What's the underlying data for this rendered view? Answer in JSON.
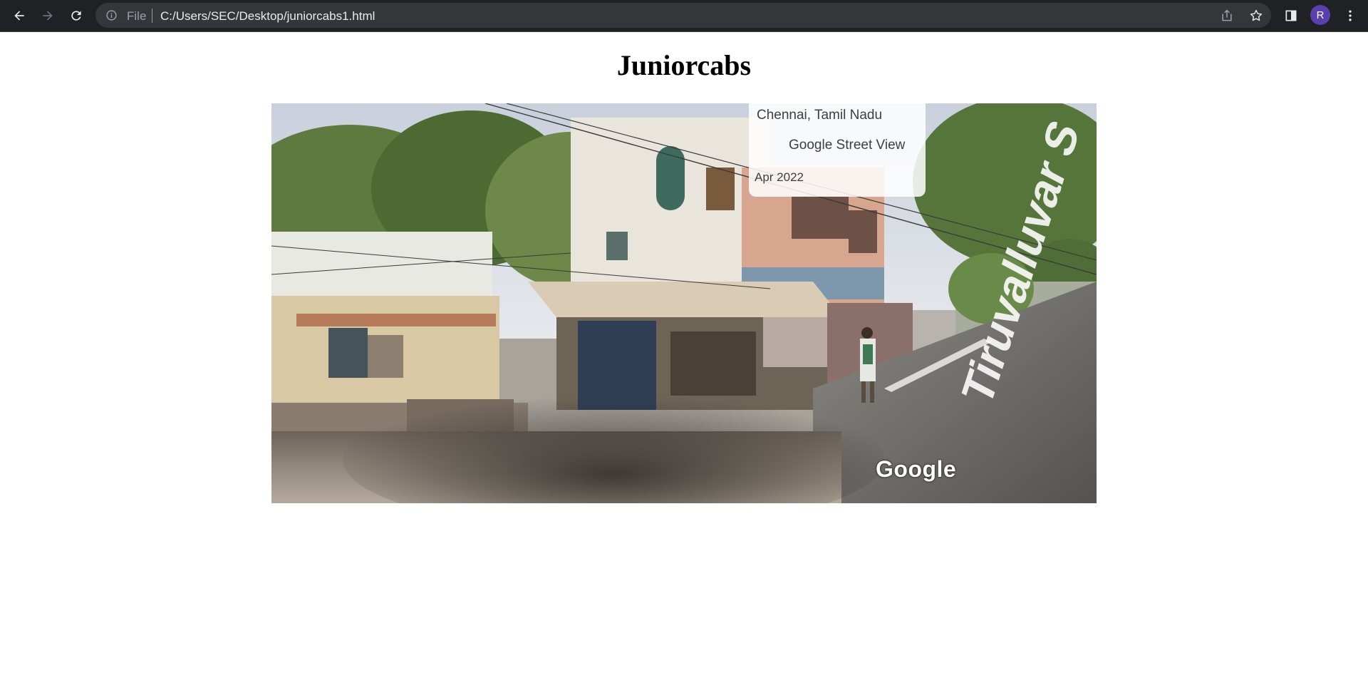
{
  "browser": {
    "scheme_label": "File",
    "url": "C:/Users/SEC/Desktop/juniorcabs1.html",
    "profile_initial": "R",
    "icons": [
      "back-icon",
      "forward-icon",
      "reload-icon",
      "info-icon",
      "share-icon",
      "star-icon",
      "side-panel-icon",
      "more-vert-icon"
    ]
  },
  "page": {
    "title": "Juniorcabs"
  },
  "street_view": {
    "location": "Chennai, Tamil Nadu",
    "source": "Google Street View",
    "date": "Apr 2022",
    "watermark": "Google",
    "street_name": "Tiruvalluvar S"
  },
  "colors": {
    "chrome_bg": "#202124",
    "omnibox_bg": "#35363a",
    "avatar_bg": "#5b3fb1"
  }
}
